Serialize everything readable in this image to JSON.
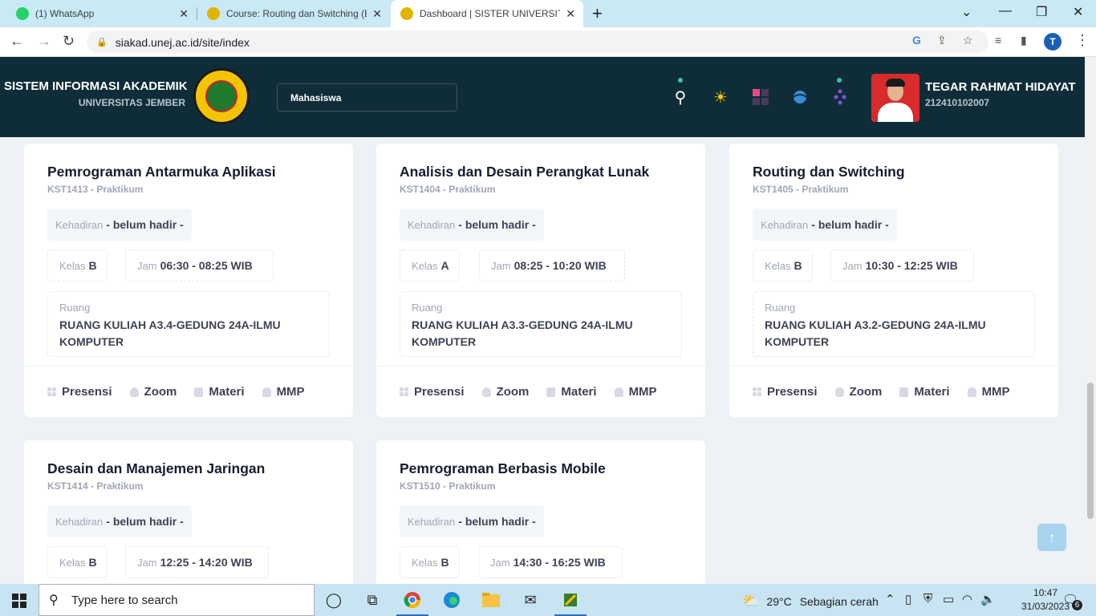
{
  "browser": {
    "tabs": [
      {
        "title": "(1) WhatsApp",
        "icon": "whatsapp-icon",
        "color": "#25d366"
      },
      {
        "title": "Course: Routing dan Switching (B",
        "icon": "unej-icon",
        "color": "#e0b400"
      },
      {
        "title": "Dashboard | SISTER UNIVERSITAS",
        "icon": "unej-icon",
        "color": "#e0b400",
        "active": true
      }
    ],
    "url": "siakad.unej.ac.id/site/index",
    "profile_initial": "T"
  },
  "header": {
    "title": "SISTEM INFORMASI AKADEMIK",
    "subtitle": "UNIVERSITAS JEMBER",
    "role": "Mahasiswa",
    "user_name": "TEGAR RAHMAT HIDAYAT",
    "user_id": "212410102007"
  },
  "labels": {
    "attendance": "Kehadiran",
    "class": "Kelas",
    "time": "Jam",
    "room": "Ruang",
    "actions": [
      "Presensi",
      "Zoom",
      "Materi",
      "MMP"
    ]
  },
  "courses": [
    {
      "title": "Pemrograman Antarmuka Aplikasi",
      "code": "KST1413 - Praktikum",
      "attendance": "- belum hadir -",
      "class": "B",
      "time": "06:30 - 08:25 WIB",
      "room_line1": "RUANG KULIAH A3.4-GEDUNG 24A-ILMU",
      "room_line2": "KOMPUTER"
    },
    {
      "title": "Analisis dan Desain Perangkat Lunak",
      "code": "KST1404 - Praktikum",
      "attendance": "- belum hadir -",
      "class": "A",
      "time": "08:25 - 10:20 WIB",
      "room_line1": "RUANG KULIAH A3.3-GEDUNG 24A-ILMU",
      "room_line2": "KOMPUTER"
    },
    {
      "title": "Routing dan Switching",
      "code": "KST1405 - Praktikum",
      "attendance": "- belum hadir -",
      "class": "B",
      "time": "10:30 - 12:25 WIB",
      "room_line1": "RUANG KULIAH A3.2-GEDUNG 24A-ILMU",
      "room_line2": "KOMPUTER"
    },
    {
      "title": "Desain dan Manajemen Jaringan",
      "code": "KST1414 - Praktikum",
      "attendance": "- belum hadir -",
      "class": "B",
      "time": "12:25 - 14:20 WIB"
    },
    {
      "title": "Pemrograman Berbasis Mobile",
      "code": "KST1510 - Praktikum",
      "attendance": "- belum hadir -",
      "class": "B",
      "time": "14:30 - 16:25 WIB"
    }
  ],
  "taskbar": {
    "search_placeholder": "Type here to search",
    "temperature": "29°C",
    "weather": "Sebagian cerah",
    "time": "10:47",
    "date": "31/03/2023",
    "notification_count": "6"
  },
  "colors": {
    "header_bg": "#0f2d38",
    "title_text": "#181c32",
    "muted_text": "#a1a5b7"
  }
}
